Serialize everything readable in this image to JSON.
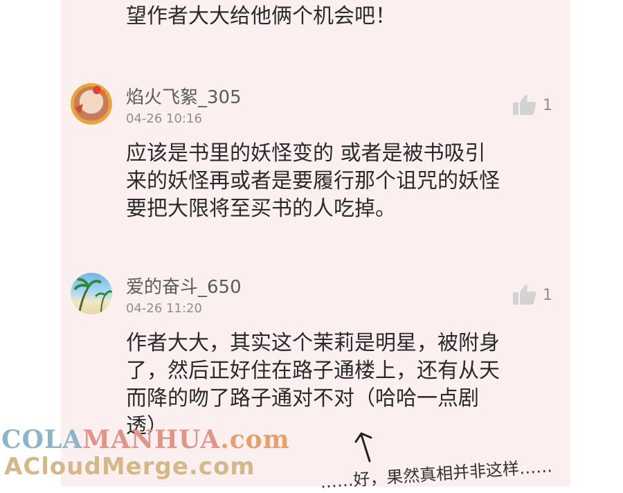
{
  "previous_comment": {
    "text_tail": "望作者大大给他俩个机会吧！"
  },
  "comments": [
    {
      "username": "焰火飞絮_305",
      "time": "04-26 10:16",
      "likes": "1",
      "lines": [
        "应该是书里的妖怪变的 或者是被书吸引",
        "来的妖怪再或者是要履行那个诅咒的妖怪",
        "要把大限将至买书的人吃掉。"
      ]
    },
    {
      "username": "爱的奋斗_650",
      "time": "04-26 11:20",
      "likes": "1",
      "lines": [
        "作者大大，其实这个茉莉是明星，被附身",
        "了，然后正好住在路子通楼上，还有从天",
        "而降的吻了路子通对不对（哈哈一点剧",
        "透）"
      ]
    }
  ],
  "watermark": {
    "line1_part1": "COLA",
    "line1_part2": "MANHUA",
    "line1_part3": ".com",
    "line2": "ACloudMerge.com"
  },
  "handwritten_note": "……好，果然真相并非这样……",
  "colors": {
    "panel_bg": "#fbf0ef",
    "text": "#2a2a2a",
    "meta": "#8e8e8e"
  },
  "icons": [
    "thumbs-up-icon",
    "avatar",
    "arrow-icon"
  ]
}
